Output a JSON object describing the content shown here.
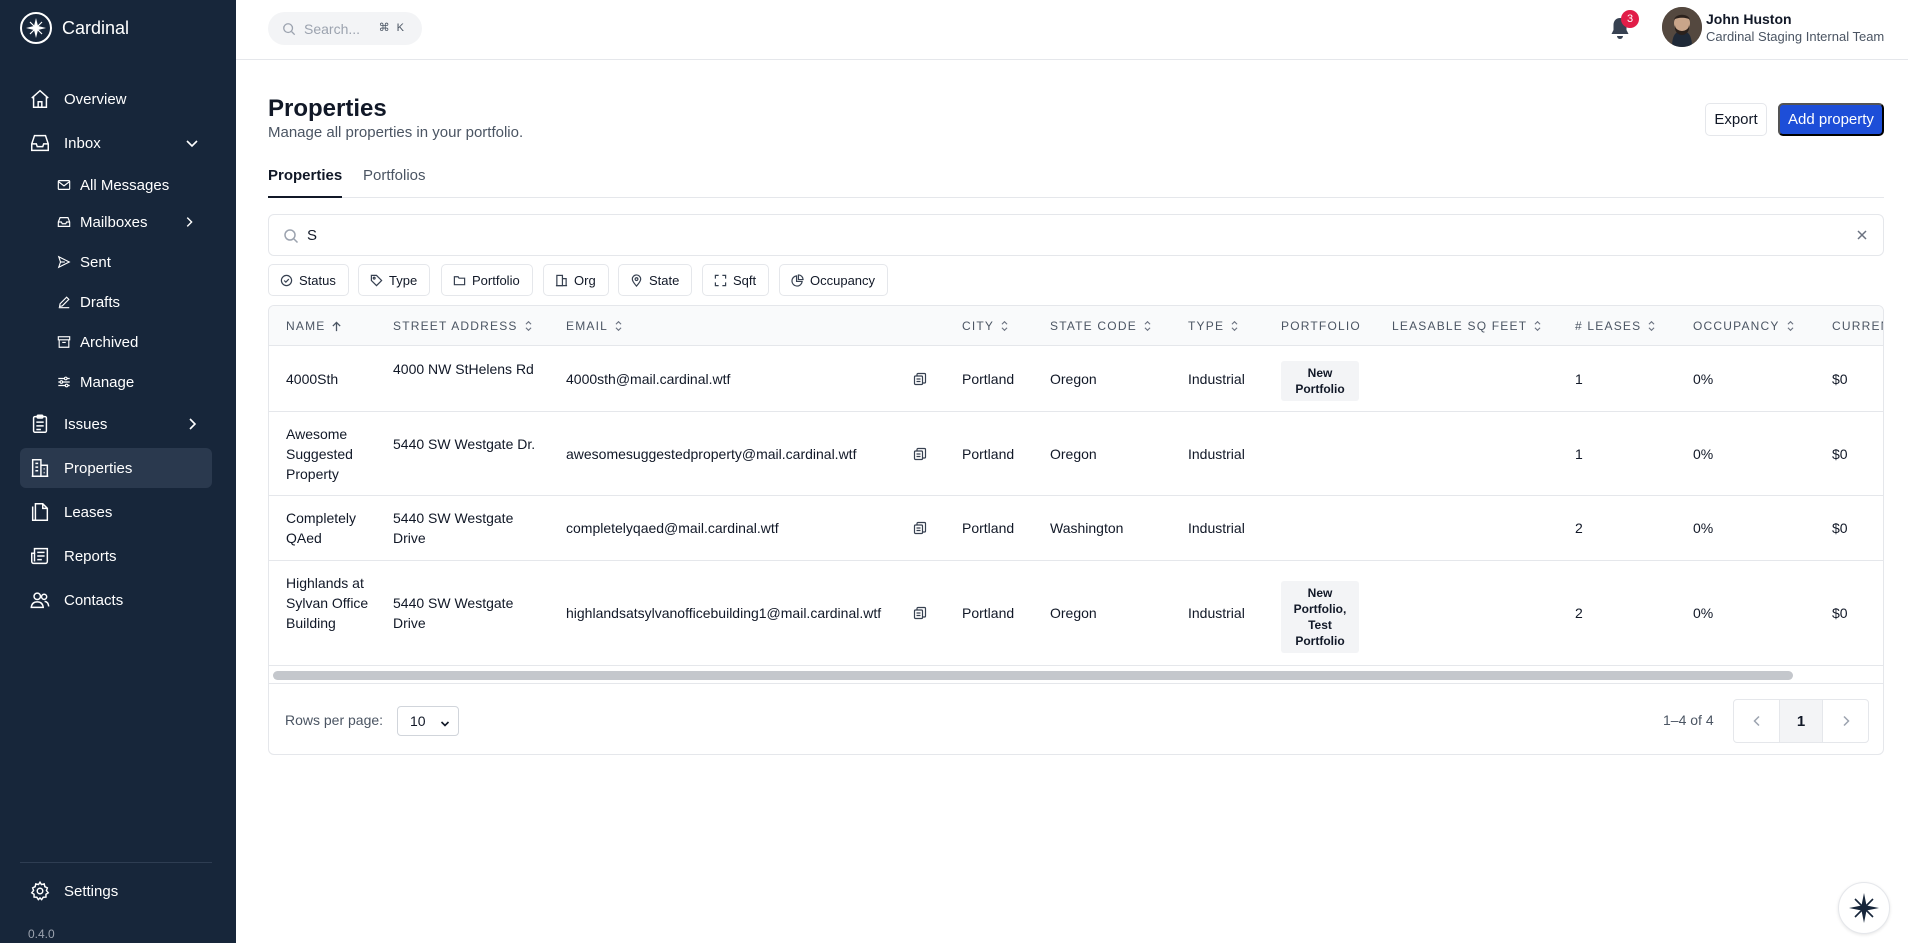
{
  "app": {
    "name": "Cardinal",
    "version": "0.4.0"
  },
  "sidebar": {
    "items": [
      {
        "label": "Overview",
        "icon": "home-icon"
      },
      {
        "label": "Inbox",
        "icon": "inbox-icon",
        "expanded": true
      },
      {
        "label": "Issues",
        "icon": "clipboard-icon"
      },
      {
        "label": "Properties",
        "icon": "building-icon",
        "active": true
      },
      {
        "label": "Leases",
        "icon": "document-icon"
      },
      {
        "label": "Reports",
        "icon": "newspaper-icon"
      },
      {
        "label": "Contacts",
        "icon": "users-icon"
      }
    ],
    "inbox_sub": [
      {
        "label": "All Messages",
        "icon": "envelope-icon"
      },
      {
        "label": "Mailboxes",
        "icon": "mailbox-icon"
      },
      {
        "label": "Sent",
        "icon": "send-icon"
      },
      {
        "label": "Drafts",
        "icon": "pencil-icon"
      },
      {
        "label": "Archived",
        "icon": "archive-icon"
      },
      {
        "label": "Manage",
        "icon": "sliders-icon"
      }
    ],
    "settings": {
      "label": "Settings",
      "icon": "gear-icon"
    }
  },
  "topbar": {
    "search_placeholder": "Search...",
    "search_shortcut": "⌘ K",
    "notification_count": "3",
    "user": {
      "name": "John Huston",
      "org": "Cardinal Staging Internal Team"
    }
  },
  "page": {
    "title": "Properties",
    "subtitle": "Manage all properties in your portfolio.",
    "export_label": "Export",
    "add_label": "Add property",
    "tabs": [
      {
        "label": "Properties",
        "active": true
      },
      {
        "label": "Portfolios",
        "active": false
      }
    ],
    "filter_query": "S",
    "filters": [
      "Status",
      "Type",
      "Portfolio",
      "Org",
      "State",
      "Sqft",
      "Occupancy"
    ]
  },
  "table": {
    "columns": [
      "NAME",
      "STREET ADDRESS",
      "EMAIL",
      "CITY",
      "STATE CODE",
      "TYPE",
      "PORTFOLIO",
      "LEASABLE SQ FEET",
      "# LEASES",
      "OCCUPANCY",
      "CURREN"
    ],
    "rows": [
      {
        "name": "4000Sth",
        "street": "4000 NW StHelens Rd",
        "email": "4000sth@mail.cardinal.wtf",
        "city": "Portland",
        "state": "Oregon",
        "type": "Industrial",
        "portfolio": "New Portfolio",
        "sqft": "",
        "leases": "1",
        "occupancy": "0%",
        "current": "$0"
      },
      {
        "name": "Awesome Suggested Property",
        "street": "5440 SW Westgate Dr.",
        "email": "awesomesuggestedproperty@mail.cardinal.wtf",
        "city": "Portland",
        "state": "Oregon",
        "type": "Industrial",
        "portfolio": "",
        "sqft": "",
        "leases": "1",
        "occupancy": "0%",
        "current": "$0"
      },
      {
        "name": "Completely QAed",
        "street": "5440 SW Westgate Drive",
        "email": "completelyqaed@mail.cardinal.wtf",
        "city": "Portland",
        "state": "Washington",
        "type": "Industrial",
        "portfolio": "",
        "sqft": "",
        "leases": "2",
        "occupancy": "0%",
        "current": "$0"
      },
      {
        "name": "Highlands at Sylvan Office Building",
        "street": "5440 SW Westgate Drive",
        "email": "highlandsatsylvanofficebuilding1@mail.cardinal.wtf",
        "city": "Portland",
        "state": "Oregon",
        "type": "Industrial",
        "portfolio": "New Portfolio, Test Portfolio",
        "sqft": "",
        "leases": "2",
        "occupancy": "0%",
        "current": "$0"
      }
    ],
    "footer": {
      "rows_per_page_label": "Rows per page:",
      "rows_per_page": "10",
      "range": "1–4 of 4",
      "page": "1"
    }
  },
  "colors": {
    "sidebar_bg": "#17263a",
    "primary": "#1d4ed8",
    "badge": "#e11d48"
  }
}
